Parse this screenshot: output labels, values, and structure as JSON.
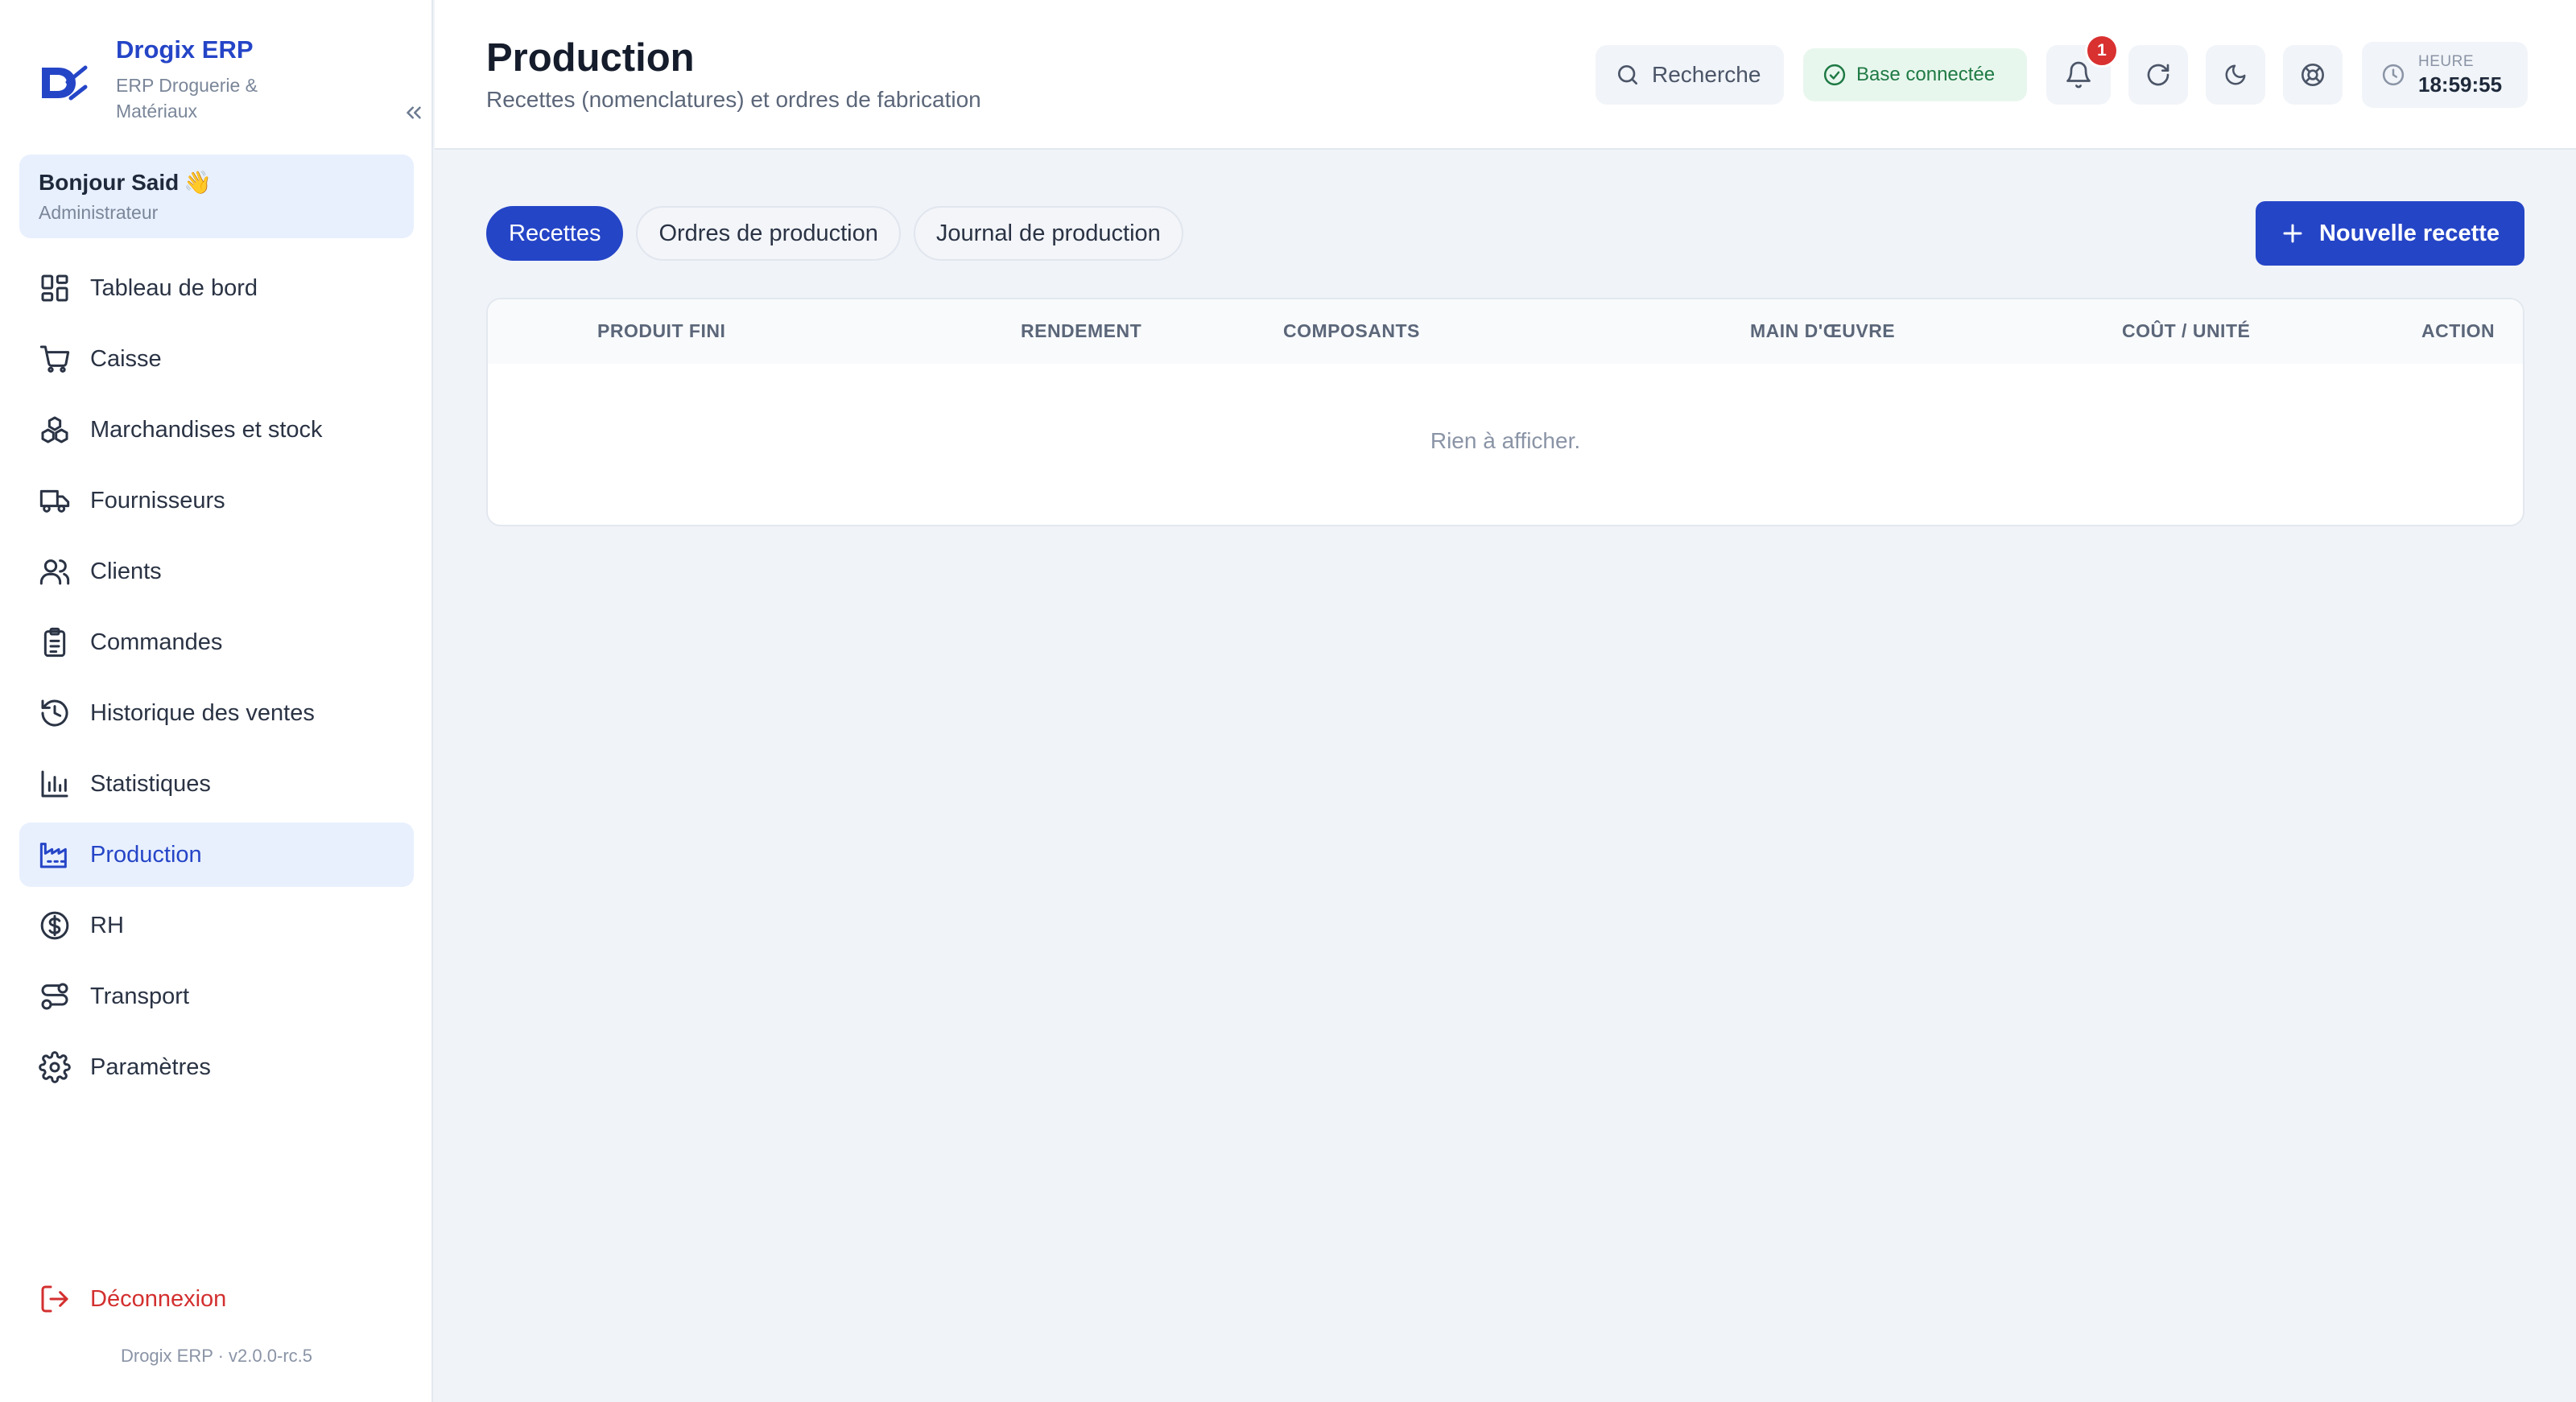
{
  "brand": {
    "name": "Drogix ERP",
    "subtitle": "ERP Droguerie & Matériaux"
  },
  "user": {
    "greeting": "Bonjour Said",
    "greeting_emoji": "👋",
    "role": "Administrateur"
  },
  "sidebar": {
    "items": [
      {
        "label": "Tableau de bord",
        "icon": "dashboard-icon"
      },
      {
        "label": "Caisse",
        "icon": "cart-icon"
      },
      {
        "label": "Marchandises et stock",
        "icon": "boxes-icon"
      },
      {
        "label": "Fournisseurs",
        "icon": "truck-icon"
      },
      {
        "label": "Clients",
        "icon": "users-icon"
      },
      {
        "label": "Commandes",
        "icon": "clipboard-icon"
      },
      {
        "label": "Historique des ventes",
        "icon": "history-icon"
      },
      {
        "label": "Statistiques",
        "icon": "bar-chart-icon"
      },
      {
        "label": "Production",
        "icon": "factory-icon",
        "active": true
      },
      {
        "label": "RH",
        "icon": "dollar-circle-icon"
      },
      {
        "label": "Transport",
        "icon": "route-icon"
      },
      {
        "label": "Paramètres",
        "icon": "gear-icon"
      }
    ],
    "logout_label": "Déconnexion",
    "version": "Drogix ERP · v2.0.0-rc.5"
  },
  "header": {
    "title": "Production",
    "subtitle": "Recettes (nomenclatures) et ordres de fabrication",
    "search_label": "Recherche",
    "db_status": "Base connectée",
    "notification_count": "1",
    "clock_label": "HEURE",
    "clock_time": "18:59:55"
  },
  "tabs": [
    {
      "label": "Recettes",
      "active": true
    },
    {
      "label": "Ordres de production",
      "active": false
    },
    {
      "label": "Journal de production",
      "active": false
    }
  ],
  "actions": {
    "new_recipe": "Nouvelle recette"
  },
  "table": {
    "columns": [
      "PRODUIT FINI",
      "RENDEMENT",
      "COMPOSANTS",
      "MAIN D'ŒUVRE",
      "COÛT / UNITÉ",
      "ACTION"
    ],
    "empty_message": "Rien à afficher."
  },
  "colors": {
    "accent": "#2545c7",
    "danger": "#d32f2f",
    "success": "#1f7a44",
    "background": "#f0f3f8"
  }
}
